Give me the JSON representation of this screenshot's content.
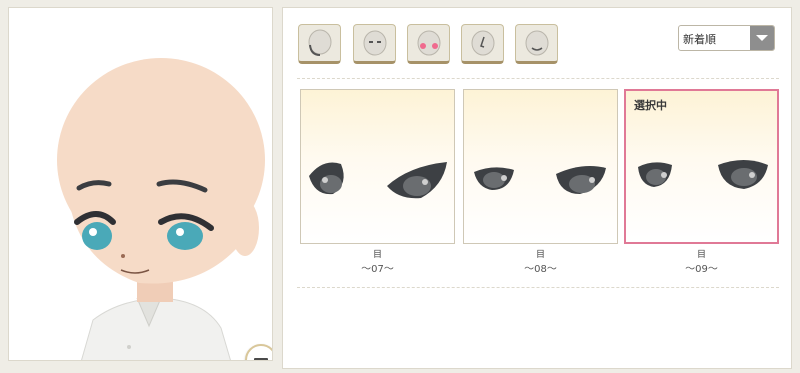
{
  "editor": {
    "sort": {
      "selected": "新着順"
    },
    "category_tabs": [
      {
        "icon": "face-shape-icon"
      },
      {
        "icon": "eyes-icon"
      },
      {
        "icon": "cheeks-icon"
      },
      {
        "icon": "nose-icon"
      },
      {
        "icon": "mouth-icon"
      }
    ],
    "items": [
      {
        "flag": "目",
        "name": "～07～",
        "selected": false
      },
      {
        "flag": "目",
        "name": "～08～",
        "selected": false
      },
      {
        "flag": "目",
        "name": "～09～",
        "selected": true
      }
    ],
    "selected_badge": "選択中"
  },
  "preview": {
    "zoom_icon": "zoom-out-icon"
  },
  "colors": {
    "skin": "#f6dbc7",
    "eye": "#4aa9b8",
    "selected_border": "#e07996",
    "card_top": "#fdf3d6"
  }
}
